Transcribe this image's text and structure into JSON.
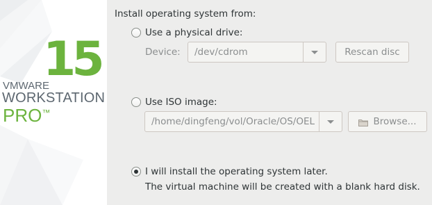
{
  "brand": {
    "version": "15",
    "vendor": "VMWARE",
    "product": "WORKSTATION",
    "edition": "PRO",
    "trademark": "™",
    "colors": {
      "green": "#6cb33e",
      "gray": "#5d6770"
    }
  },
  "install": {
    "title": "Install operating system from:",
    "physical": {
      "label": "Use a physical drive:",
      "device_label": "Device:",
      "device_value": "/dev/cdrom",
      "rescan_label": "Rescan disc",
      "selected": false
    },
    "iso": {
      "label": "Use ISO image:",
      "path_value": "/home/dingfeng/vol/Oracle/OS/OEL",
      "browse_label": "Browse...",
      "browse_icon": "folder-icon",
      "selected": false
    },
    "later": {
      "label": "I will install the operating system later.",
      "note": "The virtual machine will be created with a blank hard disk.",
      "selected": true
    }
  },
  "colors": {
    "panel_bg": "#ededec",
    "text": "#2e3436",
    "disabled_text": "#8b8e8f"
  }
}
